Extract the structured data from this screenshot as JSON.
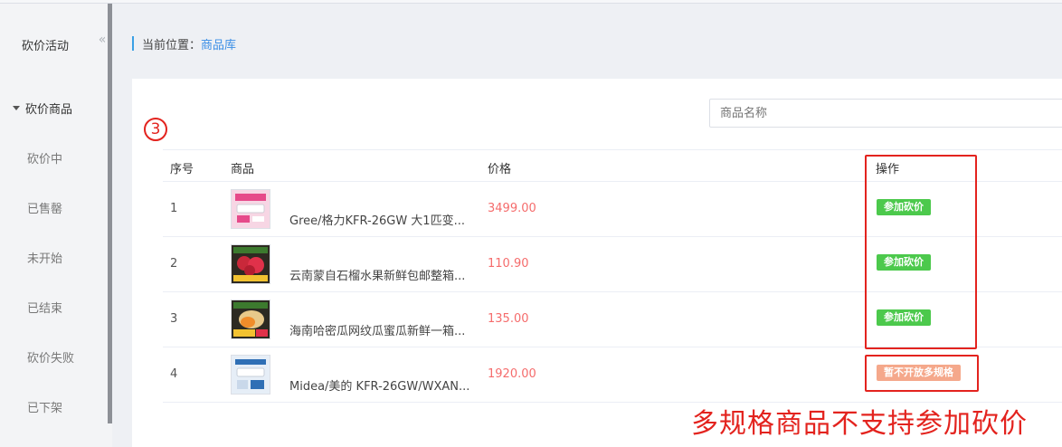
{
  "sidebar": {
    "title": "砍价活动",
    "collapse_icon": "«",
    "group": "砍价商品",
    "items": [
      "砍价中",
      "已售罄",
      "未开始",
      "已结束",
      "砍价失败",
      "已下架"
    ]
  },
  "breadcrumb": {
    "label": "当前位置：",
    "link": "商品库"
  },
  "search": {
    "placeholder": "商品名称"
  },
  "step_marker": "3",
  "table": {
    "headers": {
      "index": "序号",
      "product": "商品",
      "price": "价格",
      "action": "操作"
    },
    "rows": [
      {
        "index": "1",
        "name": "Gree/格力KFR-26GW 大1匹变...",
        "price": "3499.00",
        "action": "参加砍价",
        "action_type": "enabled"
      },
      {
        "index": "2",
        "name": "云南蒙自石榴水果新鲜包邮整箱...",
        "price": "110.90",
        "action": "参加砍价",
        "action_type": "enabled"
      },
      {
        "index": "3",
        "name": "海南哈密瓜网纹瓜蜜瓜新鲜一箱...",
        "price": "135.00",
        "action": "参加砍价",
        "action_type": "enabled"
      },
      {
        "index": "4",
        "name": "Midea/美的 KFR-26GW/WXAN...",
        "price": "1920.00",
        "action": "暂不开放多规格",
        "action_type": "disabled"
      }
    ]
  },
  "annotation": "多规格商品不支持参加砍价",
  "colors": {
    "accent": "#3a8ee6",
    "price": "#f56c6c",
    "button_green": "#4cc94c",
    "button_disabled": "#f5a88b",
    "annotation_red": "#e3231e"
  }
}
